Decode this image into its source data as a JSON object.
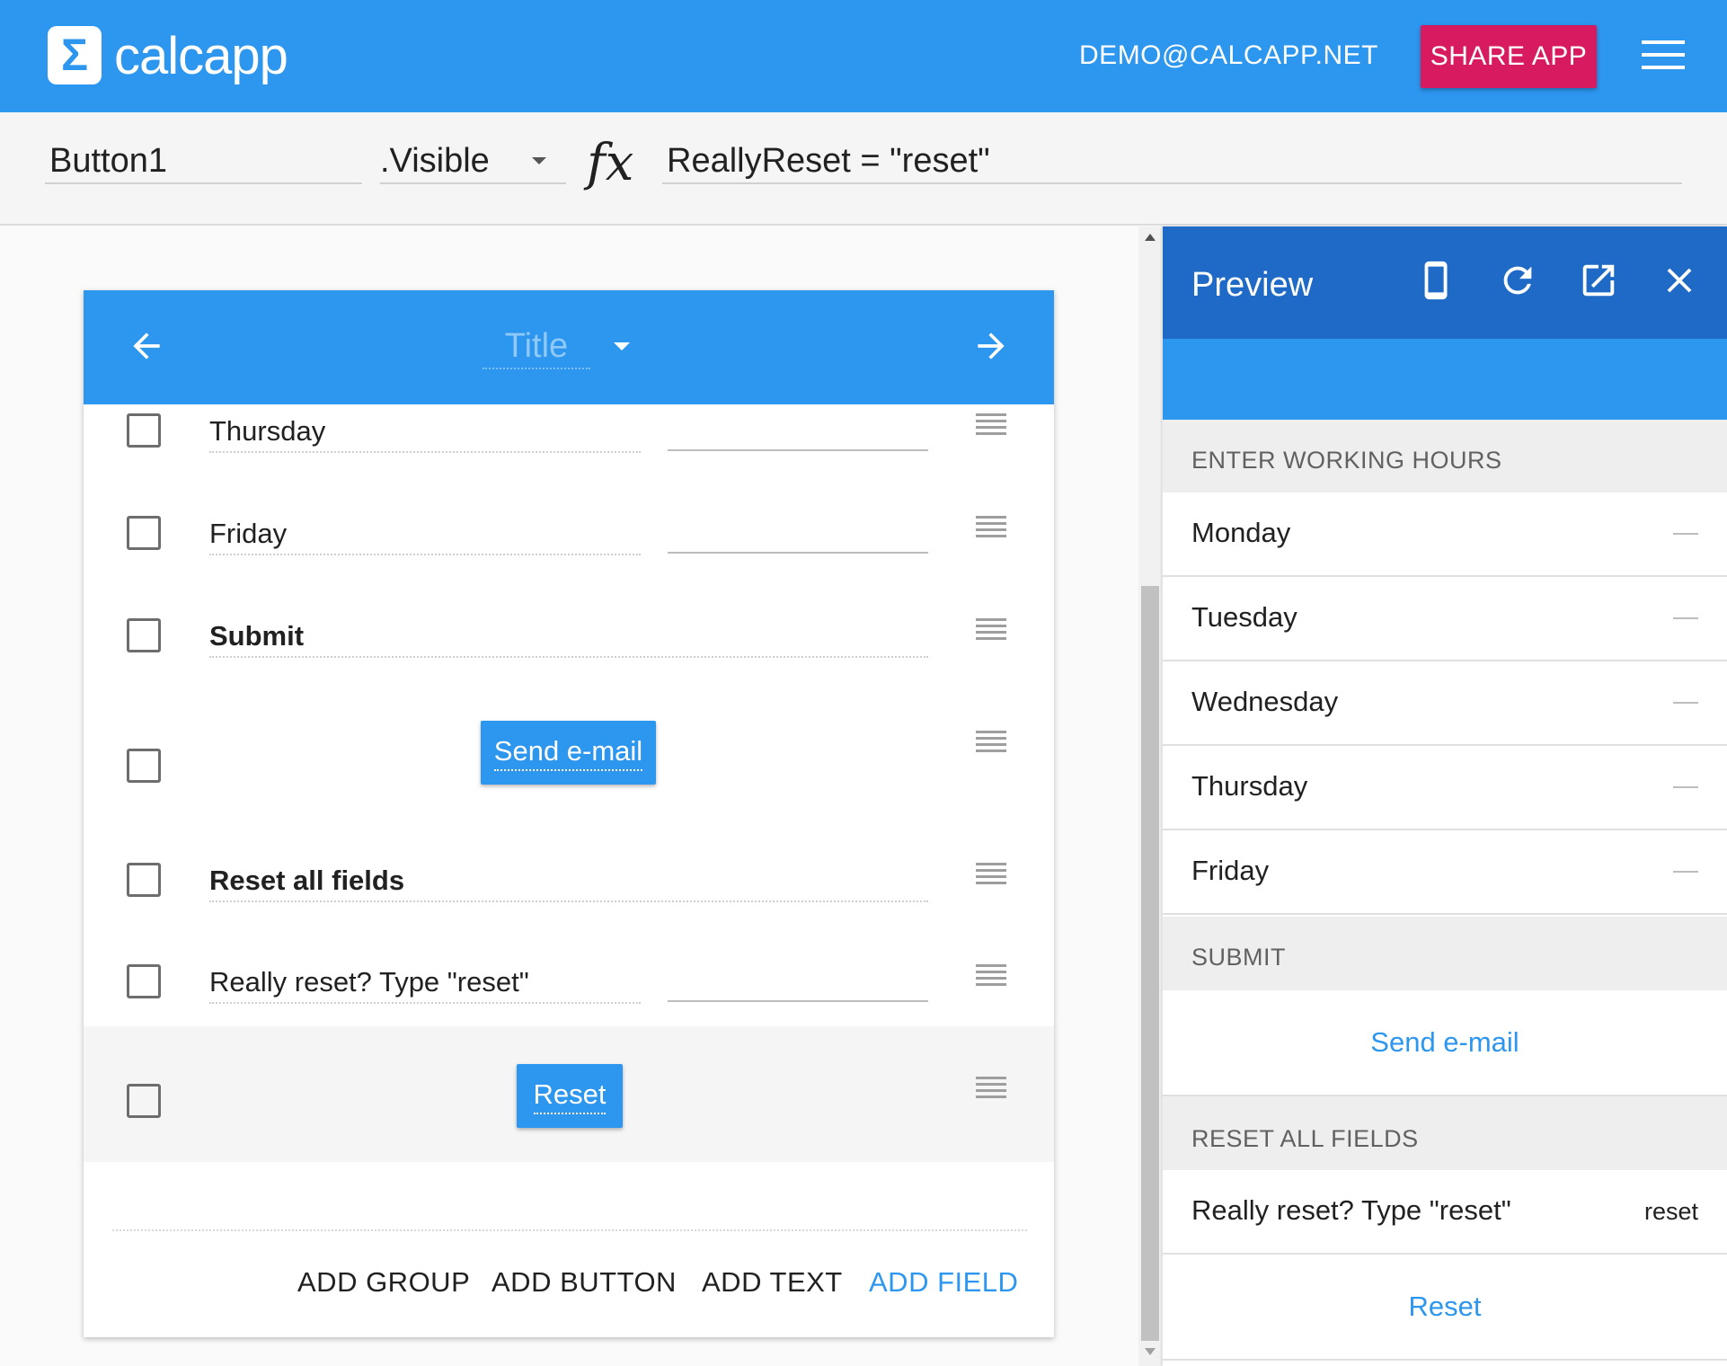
{
  "app": {
    "logo_glyph": "Σ",
    "name": "calcapp",
    "user_email": "DEMO@CALCAPP.NET",
    "share_label": "SHARE APP",
    "accent_color": "#2d96ee",
    "share_color": "#d81b60"
  },
  "formula_bar": {
    "element_name": "Button1",
    "property": ".Visible",
    "fx_label": "fx",
    "formula": "ReallyReset = \"reset\""
  },
  "designer": {
    "screen_title_placeholder": "Title",
    "rows": [
      {
        "label": "Thursday"
      },
      {
        "label": "Friday"
      },
      {
        "label": "Submit"
      },
      {
        "button_label": "Send e-mail"
      },
      {
        "label": "Reset all fields"
      },
      {
        "label": "Really reset? Type \"reset\""
      },
      {
        "button_label": "Reset"
      }
    ],
    "add_actions": {
      "group": "ADD GROUP",
      "button": "ADD BUTTON",
      "text": "ADD TEXT",
      "field": "ADD FIELD"
    }
  },
  "preview": {
    "title": "Preview",
    "group_working_hours": "ENTER WORKING HOURS",
    "days": [
      "Monday",
      "Tuesday",
      "Wednesday",
      "Thursday",
      "Friday"
    ],
    "group_submit": "SUBMIT",
    "send_email_label": "Send e-mail",
    "group_reset": "RESET ALL FIELDS",
    "reset_prompt_label": "Really reset? Type \"reset\"",
    "reset_prompt_value": "reset",
    "reset_label": "Reset"
  }
}
